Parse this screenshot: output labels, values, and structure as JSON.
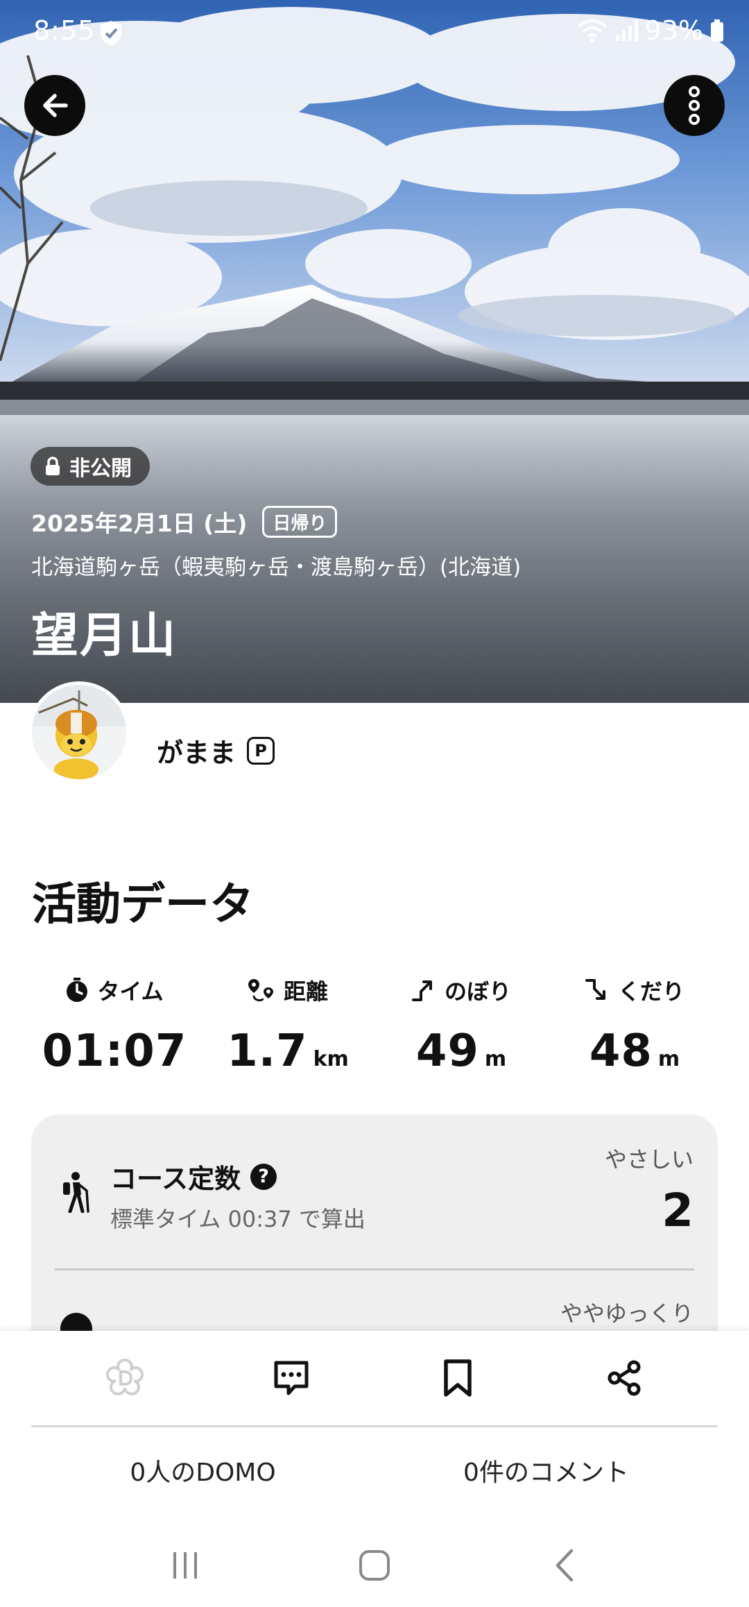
{
  "status_bar": {
    "time": "8:55",
    "battery": "93%"
  },
  "hero": {
    "privacy": "非公開",
    "date": "2025年2月1日 (土)",
    "trip_type": "日帰り",
    "area": "北海道駒ヶ岳（蝦夷駒ヶ岳・渡島駒ヶ岳）(北海道)",
    "title": "望月山"
  },
  "user": {
    "name": "がまま",
    "premium_mark": "P"
  },
  "activity": {
    "section_title": "活動データ",
    "stats": [
      {
        "icon": "stopwatch-icon",
        "label": "タイム",
        "value": "01:07",
        "unit": ""
      },
      {
        "icon": "route-pin-icon",
        "label": "距離",
        "value": "1.7",
        "unit": "km"
      },
      {
        "icon": "ascent-icon",
        "label": "のぼり",
        "value": "49",
        "unit": "m"
      },
      {
        "icon": "descent-icon",
        "label": "くだり",
        "value": "48",
        "unit": "m"
      }
    ]
  },
  "course": {
    "title": "コース定数",
    "help_mark": "?",
    "subtitle": "標準タイム 00:37 で算出",
    "level": "やさしい",
    "value": "2",
    "next_level": "ややゆっくり"
  },
  "actions": {
    "icons": [
      "domo-icon",
      "comment-icon",
      "bookmark-icon",
      "share-icon"
    ],
    "domo_count": "0人のDOMO",
    "comment_count": "0件のコメント"
  },
  "colors": {
    "accent_dark": "#111111",
    "card_bg": "#efefef",
    "domo_disabled": "#cfcfcf"
  }
}
